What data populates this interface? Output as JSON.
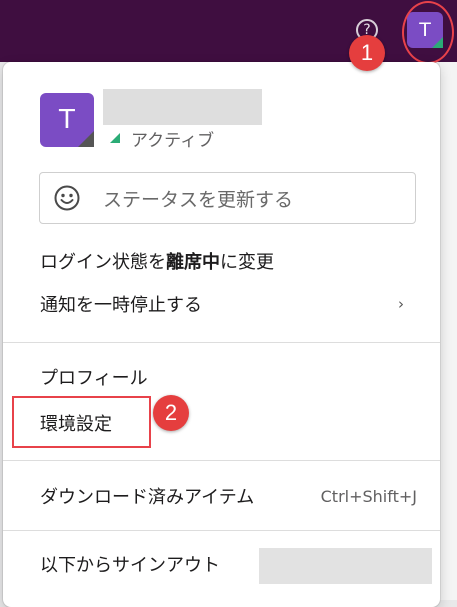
{
  "topbar": {
    "help_icon": "?",
    "avatar_initial": "T"
  },
  "callouts": [
    "1",
    "2"
  ],
  "profile": {
    "avatar_initial": "T",
    "presence_label": "アクティブ"
  },
  "status": {
    "placeholder": "ステータスを更新する",
    "icon": "smile-icon"
  },
  "menu": {
    "away_prefix": "ログイン状態を",
    "away_bold": "離席中",
    "away_suffix": "に変更",
    "pause_label": "通知を一時停止する",
    "pause_chevron": "›",
    "profile_label": "プロフィール",
    "prefs_label": "環境設定",
    "downloads_label": "ダウンロード済みアイテム",
    "downloads_shortcut": "Ctrl+Shift+J",
    "signout_label": "以下からサインアウト"
  },
  "colors": {
    "topbar": "#3f0e40",
    "avatar": "#7b4cc4",
    "presence": "#2bac76",
    "callout": "#e53e3e"
  }
}
